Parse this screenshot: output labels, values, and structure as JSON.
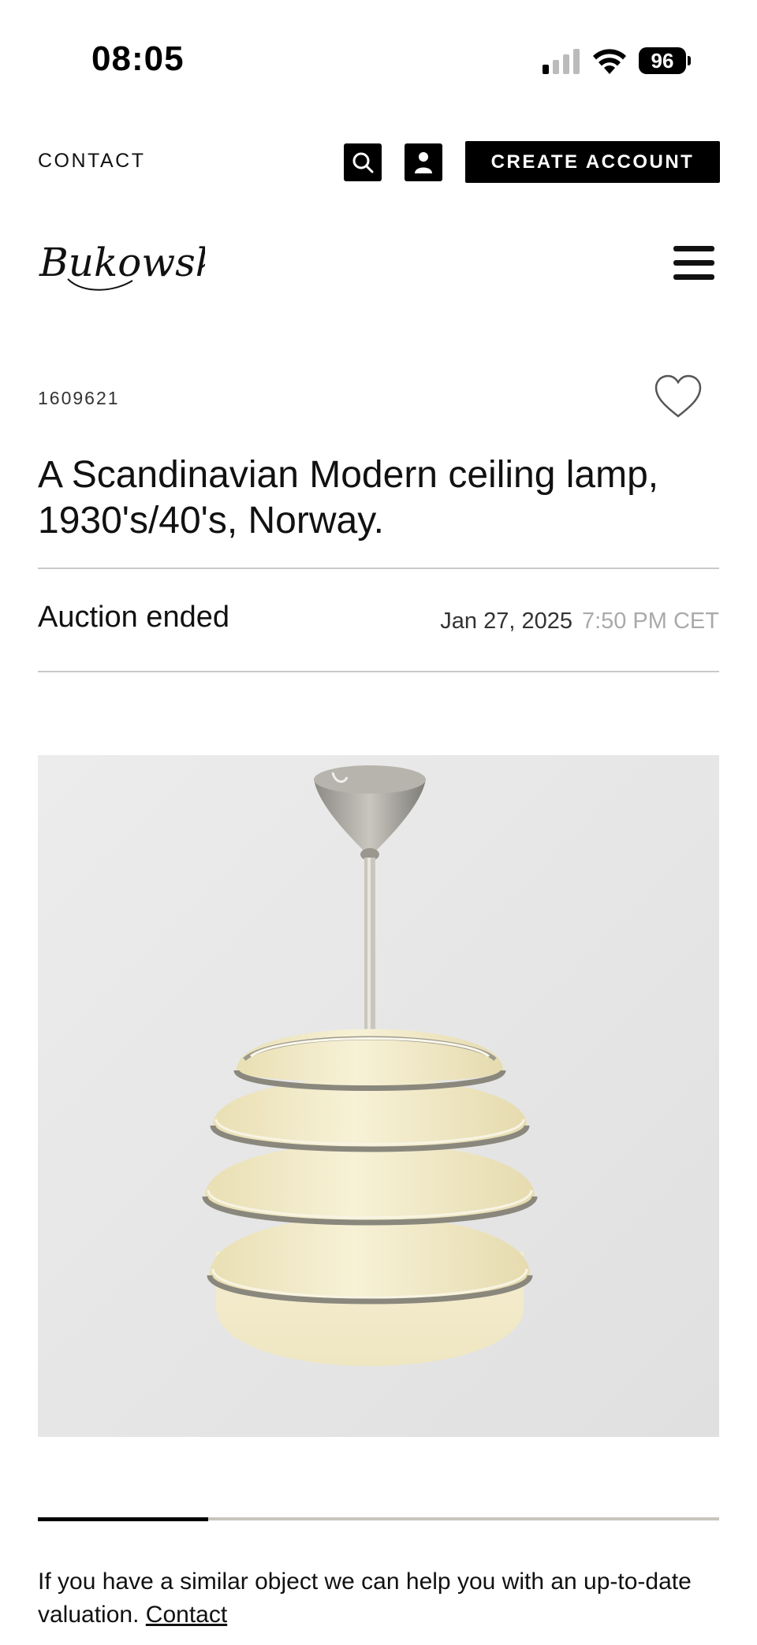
{
  "status_bar": {
    "time": "08:05",
    "battery": "96"
  },
  "top_bar": {
    "contact_label": "CONTACT",
    "search_icon": "search-icon",
    "user_icon": "user-icon",
    "create_account_label": "CREATE ACCOUNT"
  },
  "brand": {
    "logo_text": "Bukowskis"
  },
  "lot": {
    "number": "1609621",
    "title": "A Scandinavian Modern ceiling lamp, 1930's/40's, Norway.",
    "status": "Auction ended",
    "end_date": "Jan 27, 2025",
    "end_time": "7:50 PM CET"
  },
  "gallery": {
    "progress": 0.25
  },
  "valuation": {
    "text": "If you have a similar object we can help you with an up-to-date valuation.",
    "link_label": "Contact"
  },
  "colors": {
    "black": "#000000",
    "divider": "#c9c9c9",
    "muted_time": "#aaaaaa",
    "progress_track": "#c8c5bd",
    "lamp_glass": "#f1e9c4",
    "photo_bg": "#e6e6e6"
  }
}
